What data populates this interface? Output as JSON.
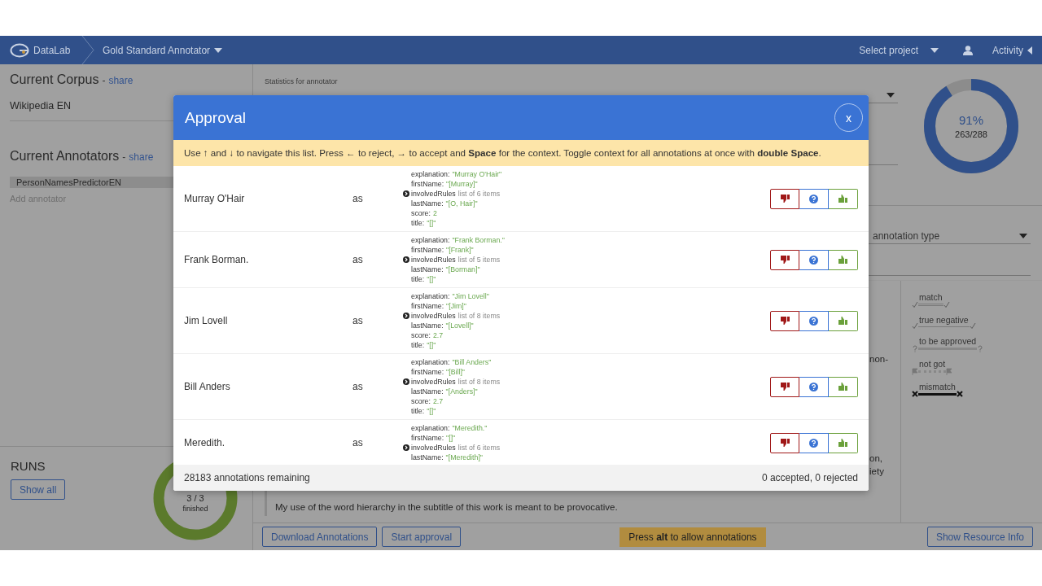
{
  "top_bar": {
    "brand": "DataLab",
    "app": "Gold Standard Annotator",
    "project_select": "Select project",
    "activity": "Activity"
  },
  "corpus": {
    "title": "Current Corpus",
    "dash": "-",
    "share": "share",
    "name": "Wikipedia EN"
  },
  "annotators": {
    "title": "Current Annotators",
    "dash": "-",
    "share": "share",
    "items": [
      "PersonNamesPredictorEN"
    ],
    "add_placeholder": "Add annotator"
  },
  "runs": {
    "title": "RUNS",
    "show_all": "Show all",
    "ratio": "3 / 3",
    "status": "finished"
  },
  "statistics": {
    "label": "Statistics for annotator",
    "percent": "91%",
    "count": "263/288",
    "level": 0.91
  },
  "filter": {
    "value": "annotation type"
  },
  "legend": [
    {
      "label": "match",
      "kind": "match"
    },
    {
      "label": "true negative",
      "kind": "true_negative"
    },
    {
      "label": "to be approved",
      "kind": "to_be_approved"
    },
    {
      "label": "not got",
      "kind": "not_got"
    },
    {
      "label": "mismatch",
      "kind": "mismatch"
    }
  ],
  "document": {
    "fragments": [
      "non-",
      "on,",
      "iety"
    ],
    "quotes": [
      "My use of the word hierarchy in the subtitle of this work is meant to be provocative."
    ]
  },
  "actions": {
    "download": "Download Annotations",
    "approval": "Start approval",
    "hint": "Press **alt** to allow annotations",
    "resource": "Show Resource Info"
  },
  "modal": {
    "title": "Approval",
    "close": "x",
    "instructions": "Use ↑ and ↓ to navigate this list. Press ← to reject, → to accept and **Space** for the context. Toggle context for all annotations at once with **double Space**.",
    "annotations": [
      {
        "text": "Murray O'Hair",
        "as": "as",
        "fields": [
          {
            "key": "explanation:",
            "value": "\"Murray O'Hair\"",
            "kind": "value"
          },
          {
            "key": "firstName:",
            "value": "\"[Murray]\"",
            "kind": "value"
          },
          {
            "key": "involvedRules",
            "value": "list of 6 items",
            "kind": "list"
          },
          {
            "key": "lastName:",
            "value": "\"[O, Hair]\"",
            "kind": "value"
          },
          {
            "key": "score:",
            "value": "2",
            "kind": "value"
          },
          {
            "key": "title:",
            "value": "\"[]\"",
            "kind": "value"
          }
        ]
      },
      {
        "text": "Frank Borman.",
        "as": "as",
        "fields": [
          {
            "key": "explanation:",
            "value": "\"Frank Borman.\"",
            "kind": "value"
          },
          {
            "key": "firstName:",
            "value": "\"[Frank]\"",
            "kind": "value"
          },
          {
            "key": "involvedRules",
            "value": "list of 5 items",
            "kind": "list"
          },
          {
            "key": "lastName:",
            "value": "\"[Borman]\"",
            "kind": "value"
          },
          {
            "key": "title:",
            "value": "\"[]\"",
            "kind": "value"
          }
        ]
      },
      {
        "text": "Jim Lovell",
        "as": "as",
        "fields": [
          {
            "key": "explanation:",
            "value": "\"Jim Lovell\"",
            "kind": "value"
          },
          {
            "key": "firstName:",
            "value": "\"[Jim]\"",
            "kind": "value"
          },
          {
            "key": "involvedRules",
            "value": "list of 8 items",
            "kind": "list"
          },
          {
            "key": "lastName:",
            "value": "\"[Lovell]\"",
            "kind": "value"
          },
          {
            "key": "score:",
            "value": "2.7",
            "kind": "value"
          },
          {
            "key": "title:",
            "value": "\"[]\"",
            "kind": "value"
          }
        ]
      },
      {
        "text": "Bill Anders",
        "as": "as",
        "fields": [
          {
            "key": "explanation:",
            "value": "\"Bill Anders\"",
            "kind": "value"
          },
          {
            "key": "firstName:",
            "value": "\"[Bill]\"",
            "kind": "value"
          },
          {
            "key": "involvedRules",
            "value": "list of 8 items",
            "kind": "list"
          },
          {
            "key": "lastName:",
            "value": "\"[Anders]\"",
            "kind": "value"
          },
          {
            "key": "score:",
            "value": "2.7",
            "kind": "value"
          },
          {
            "key": "title:",
            "value": "\"[]\"",
            "kind": "value"
          }
        ]
      },
      {
        "text": "Meredith.",
        "as": "as",
        "fields": [
          {
            "key": "explanation:",
            "value": "\"Meredith.\"",
            "kind": "value"
          },
          {
            "key": "firstName:",
            "value": "\"[]\"",
            "kind": "value"
          },
          {
            "key": "involvedRules",
            "value": "list of 6 items",
            "kind": "list"
          },
          {
            "key": "lastName:",
            "value": "\"[Meredith]\"",
            "kind": "value"
          }
        ]
      }
    ],
    "remaining": "28183 annotations remaining",
    "tally": "0 accepted, 0 rejected"
  }
}
